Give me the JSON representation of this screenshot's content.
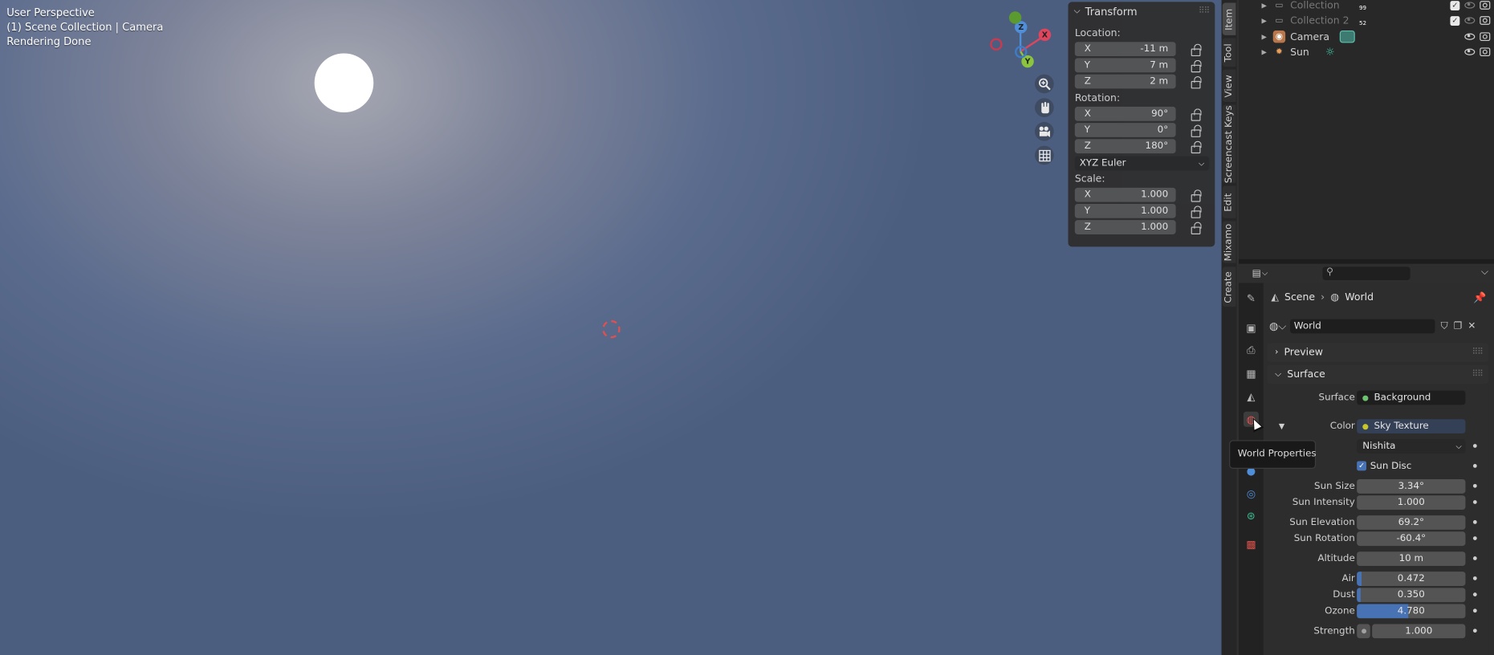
{
  "viewport": {
    "info_lines": [
      "User Perspective",
      "(1) Scene Collection | Camera",
      "Rendering Done"
    ],
    "gizmo": {
      "x_label": "X",
      "y_label": "Y",
      "z_label": "Z"
    },
    "nav_buttons": [
      "zoom-icon",
      "hand-icon",
      "camera-icon",
      "grid-icon"
    ]
  },
  "transform_panel": {
    "title": "Transform",
    "location_label": "Location:",
    "location": [
      {
        "axis": "X",
        "value": "-11 m"
      },
      {
        "axis": "Y",
        "value": "7 m"
      },
      {
        "axis": "Z",
        "value": "2 m"
      }
    ],
    "rotation_label": "Rotation:",
    "rotation": [
      {
        "axis": "X",
        "value": "90°"
      },
      {
        "axis": "Y",
        "value": "0°"
      },
      {
        "axis": "Z",
        "value": "180°"
      }
    ],
    "rotation_mode": "XYZ Euler",
    "scale_label": "Scale:",
    "scale": [
      {
        "axis": "X",
        "value": "1.000"
      },
      {
        "axis": "Y",
        "value": "1.000"
      },
      {
        "axis": "Z",
        "value": "1.000"
      }
    ]
  },
  "sidebar_tabs": [
    "Item",
    "Tool",
    "View",
    "Screencast Keys",
    "Edit",
    "Mixamo",
    "Create"
  ],
  "outliner": {
    "rows": [
      {
        "name": "Collection",
        "badge": "99"
      },
      {
        "name": "Collection 2",
        "badge": "52"
      },
      {
        "name": "Camera",
        "badge": ""
      },
      {
        "name": "Sun",
        "badge": ""
      }
    ]
  },
  "properties": {
    "search_placeholder": "",
    "breadcrumb": [
      "Scene",
      "World"
    ],
    "world_name": "World",
    "preview_label": "Preview",
    "surface_header": "Surface",
    "rows": {
      "surface_label": "Surface",
      "surface_value": "Background",
      "color_label": "Color",
      "color_value": "Sky Texture",
      "sky_type": "Nishita",
      "sun_disc_label": "Sun Disc",
      "sun_size_label": "Sun Size",
      "sun_size": "3.34°",
      "sun_intensity_label": "Sun Intensity",
      "sun_intensity": "1.000",
      "sun_elevation_label": "Sun Elevation",
      "sun_elevation": "69.2°",
      "sun_rotation_label": "Sun Rotation",
      "sun_rotation": "-60.4°",
      "altitude_label": "Altitude",
      "altitude": "10 m",
      "air_label": "Air",
      "air": "0.472",
      "air_fraction": 0.047,
      "dust_label": "Dust",
      "dust": "0.350",
      "dust_fraction": 0.035,
      "ozone_label": "Ozone",
      "ozone": "4.780",
      "ozone_fraction": 0.478,
      "strength_label": "Strength",
      "strength": "1.000"
    },
    "tooltip": "World Properties"
  },
  "colors": {
    "accent": "#4772b3",
    "node_socket_green": "#6ec46e",
    "node_socket_yellow": "#c7c729"
  }
}
